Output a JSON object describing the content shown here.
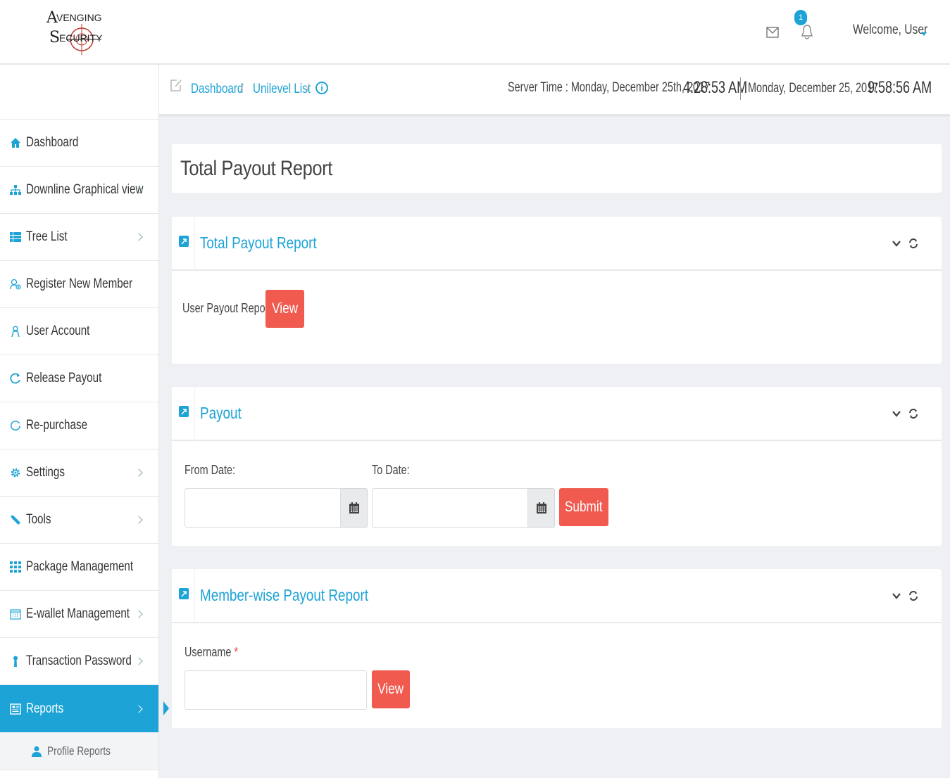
{
  "header": {
    "logo_text": "AVENGING SECURITY",
    "notification_count": "1",
    "welcome": "Welcome, User"
  },
  "breadcrumb": {
    "items": [
      "Dashboard",
      "Unilevel List"
    ],
    "separator": "/"
  },
  "clock": {
    "server_label": "Server Time : Monday, December 25th, 2017",
    "server_time": "4:28:53 AM",
    "local_date": "Monday, December 25, 2017",
    "local_time": "9:58:56 AM"
  },
  "sidebar": {
    "items": [
      {
        "label": "Dashboard",
        "icon": "home-icon",
        "chevron": false
      },
      {
        "label": "Downline Graphical view",
        "icon": "sitemap-icon",
        "chevron": true
      },
      {
        "label": "Tree List",
        "icon": "list-icon",
        "chevron": true
      },
      {
        "label": "Register New Member",
        "icon": "user-plus-icon",
        "chevron": false
      },
      {
        "label": "User Account",
        "icon": "user-icon",
        "chevron": false
      },
      {
        "label": "Release Payout",
        "icon": "refresh-icon",
        "chevron": false
      },
      {
        "label": "Re-purchase",
        "icon": "circle-icon",
        "chevron": false
      },
      {
        "label": "Settings",
        "icon": "gear-icon",
        "chevron": true
      },
      {
        "label": "Tools",
        "icon": "wrench-icon",
        "chevron": true
      },
      {
        "label": "Package Management",
        "icon": "grid-icon",
        "chevron": false
      },
      {
        "label": "E-wallet Management",
        "icon": "calendar-icon",
        "chevron": true
      },
      {
        "label": "Transaction Password",
        "icon": "key-icon",
        "chevron": true
      },
      {
        "label": "Reports",
        "icon": "report-icon",
        "chevron": true,
        "active": true
      }
    ],
    "sub_items": [
      {
        "label": "Profile Reports",
        "icon": "user-icon"
      }
    ]
  },
  "page": {
    "title": "Total Payout Report"
  },
  "panels": {
    "total_payout": {
      "title": "Total Payout Report",
      "row_label": "User Payout Report",
      "button": "View"
    },
    "payout": {
      "title": "Payout",
      "from_label": "From Date:",
      "to_label": "To Date:",
      "from_value": "",
      "to_value": "",
      "button": "Submit"
    },
    "member_wise": {
      "title": "Member-wise Payout Report",
      "username_label": "Username",
      "required_mark": "*",
      "username_value": "",
      "button": "View"
    }
  },
  "colors": {
    "accent": "#1da3d6",
    "button": "#f05a4f",
    "background": "#eef0f4"
  }
}
